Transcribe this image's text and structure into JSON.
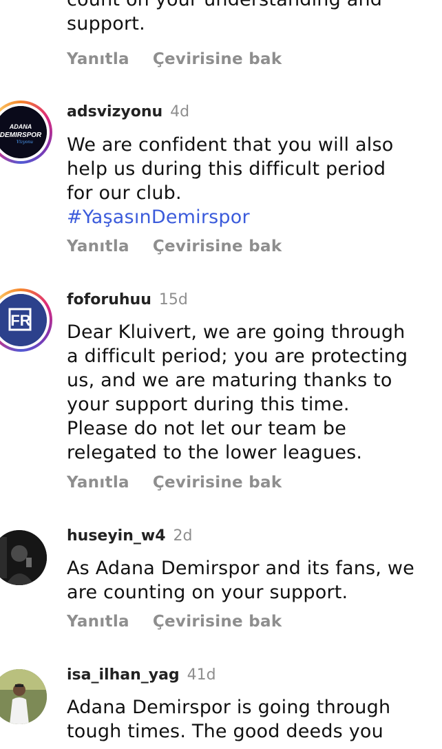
{
  "actions": {
    "reply": "Yanıtla",
    "translate": "Çevirisine bak"
  },
  "comments": [
    {
      "text_lines": [
        "count on your understanding and",
        "support."
      ]
    },
    {
      "username": "adsvizyonu",
      "time": "4d",
      "text_lines": [
        "We are confident that you will also",
        "help us during this difficult period",
        "for our club."
      ],
      "hashtag": "#YaşasınDemirspor",
      "avatar_text": [
        "ADANA",
        "DEMIRSPOR",
        "Vizyonu"
      ]
    },
    {
      "username": "foforuhuu",
      "time": "15d",
      "text_lines": [
        "Dear Kluivert, we are going through",
        "a difficult period; you are protecting",
        "us, and we are maturing thanks to",
        "your support during this time.",
        "Please do not let our team be",
        "relegated to the lower leagues."
      ],
      "avatar_text": "FR"
    },
    {
      "username": "huseyin_w4",
      "time": "2d",
      "text_lines": [
        "As Adana Demirspor and its fans, we",
        "are counting on your support."
      ]
    },
    {
      "username": "isa_ilhan_yag",
      "time": "41d",
      "text_lines": [
        "Adana Demirspor is going through",
        "tough times. The good deeds you"
      ]
    }
  ]
}
